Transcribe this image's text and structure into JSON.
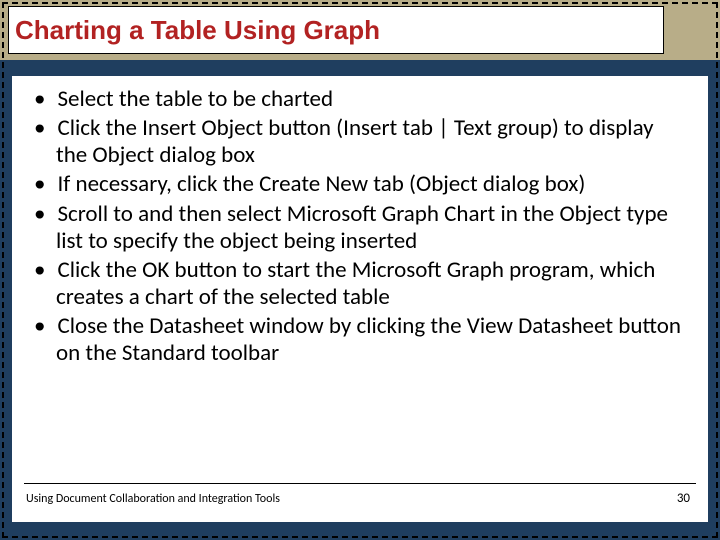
{
  "title": "Charting a Table Using Graph",
  "bullets": [
    "Select the table to be charted",
    "Click the Insert Object button (Insert tab | Text group) to display the Object dialog box",
    "If necessary, click the Create New tab (Object dialog box)",
    "Scroll to and then select Microsoft Graph Chart in the Object type list to specify the object being inserted",
    "Click the OK button to start the Microsoft Graph program, which creates a chart of the selected table",
    "Close the Datasheet window by clicking the View Datasheet button on the Standard toolbar"
  ],
  "footer": "Using Document Collaboration and Integration Tools",
  "page_number": "30"
}
